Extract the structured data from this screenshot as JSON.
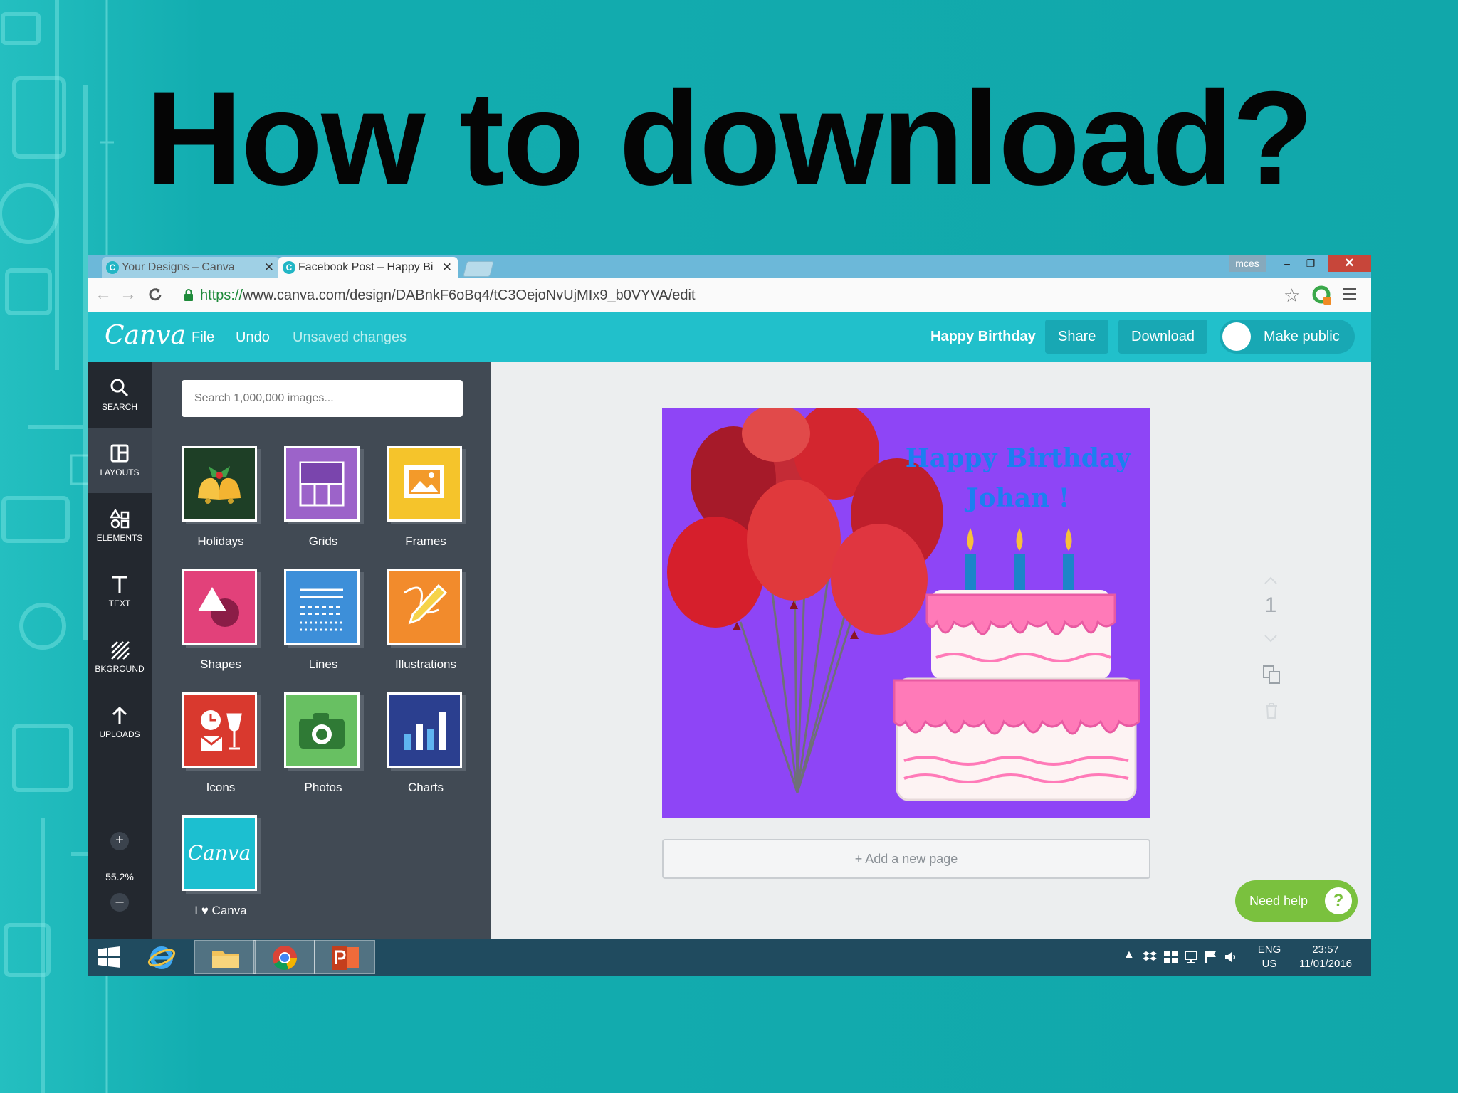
{
  "slide": {
    "title": "How to download?"
  },
  "browser": {
    "tabs": [
      {
        "label": "Your Designs – Canva",
        "favicon": "C",
        "close": "✕",
        "active": false
      },
      {
        "label": "Facebook Post – Happy Bi",
        "favicon": "C",
        "close": "✕",
        "active": true
      }
    ],
    "window_user": "mces",
    "window_controls": {
      "minimize": "–",
      "maximize": "❐",
      "close": "✕"
    },
    "nav": {
      "back": "←",
      "forward": "→",
      "reload": "C"
    },
    "url": {
      "scheme": "https://",
      "rest": "www.canva.com/design/DABnkF6oBq4/tC3OejoNvUjMIx9_b0VYVA/edit"
    },
    "star": "☆"
  },
  "canva": {
    "logo": "Canva",
    "menu": {
      "file": "File",
      "undo": "Undo",
      "status": "Unsaved changes"
    },
    "design_title": "Happy Birthday",
    "buttons": {
      "share": "Share",
      "download": "Download",
      "make_public": "Make public"
    },
    "rail": [
      {
        "label": "SEARCH",
        "icon": "search-icon"
      },
      {
        "label": "LAYOUTS",
        "icon": "layouts-icon"
      },
      {
        "label": "ELEMENTS",
        "icon": "elements-icon"
      },
      {
        "label": "TEXT",
        "icon": "text-icon"
      },
      {
        "label": "BKGROUND",
        "icon": "background-icon"
      },
      {
        "label": "UPLOADS",
        "icon": "upload-icon"
      }
    ],
    "zoom": {
      "plus": "+",
      "value": "55.2%",
      "minus": "–"
    },
    "panel": {
      "search_placeholder": "Search 1,000,000 images...",
      "categories": [
        {
          "label": "Holidays",
          "color": "#1e3f26"
        },
        {
          "label": "Grids",
          "color": "#9c63c9"
        },
        {
          "label": "Frames",
          "color": "#f5c42b"
        },
        {
          "label": "Shapes",
          "color": "#e2417a"
        },
        {
          "label": "Lines",
          "color": "#3d8fd9"
        },
        {
          "label": "Illustrations",
          "color": "#f28b2c"
        },
        {
          "label": "Icons",
          "color": "#d9392e"
        },
        {
          "label": "Photos",
          "color": "#68c062"
        },
        {
          "label": "Charts",
          "color": "#2b3f8f"
        },
        {
          "label": "I ♥ Canva",
          "color": "#1cbfd0"
        }
      ],
      "canva_tile_logo": "Canva"
    },
    "design": {
      "text_line1": "Happy Birthday",
      "text_line2": "Johan !",
      "background": "#8e45f6"
    },
    "add_page": "+ Add a new page",
    "page_number": "1",
    "help": {
      "label": "Need help",
      "icon": "?"
    }
  },
  "taskbar": {
    "lang_line1": "ENG",
    "lang_line2": "US",
    "time": "23:57",
    "date": "11/01/2016",
    "tray_up": "▲"
  }
}
